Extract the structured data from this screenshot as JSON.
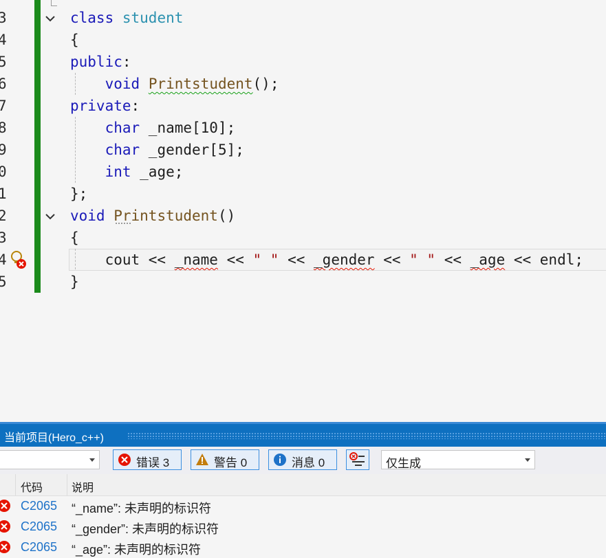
{
  "editor": {
    "line_numbers": [
      "3",
      "4",
      "5",
      "6",
      "7",
      "8",
      "9",
      "0",
      "1",
      "2",
      "3",
      "4",
      "5"
    ],
    "lines": [
      {
        "tokens": [
          {
            "t": "class",
            "c": "kw"
          },
          {
            "t": " "
          },
          {
            "t": "student",
            "c": "ty"
          }
        ]
      },
      {
        "tokens": [
          {
            "t": "{"
          }
        ]
      },
      {
        "tokens": [
          {
            "t": "public",
            "c": "kw"
          },
          {
            "t": ":"
          }
        ]
      },
      {
        "tokens": [
          {
            "t": "    "
          },
          {
            "t": "void",
            "c": "kw"
          },
          {
            "t": " "
          },
          {
            "t": "Printstudent",
            "c": "fn sq-green"
          },
          {
            "t": "();"
          }
        ]
      },
      {
        "tokens": [
          {
            "t": "private",
            "c": "kw"
          },
          {
            "t": ":"
          }
        ]
      },
      {
        "tokens": [
          {
            "t": "    "
          },
          {
            "t": "char",
            "c": "kw"
          },
          {
            "t": " _name[10];"
          }
        ]
      },
      {
        "tokens": [
          {
            "t": "    "
          },
          {
            "t": "char",
            "c": "kw"
          },
          {
            "t": " _gender[5];"
          }
        ]
      },
      {
        "tokens": [
          {
            "t": "    "
          },
          {
            "t": "int",
            "c": "kw"
          },
          {
            "t": " _age;"
          }
        ]
      },
      {
        "tokens": [
          {
            "t": "};"
          }
        ]
      },
      {
        "tokens": [
          {
            "t": "void",
            "c": "kw"
          },
          {
            "t": " "
          },
          {
            "t": "Printstudent",
            "c": "fn"
          },
          {
            "t": "()"
          }
        ]
      },
      {
        "tokens": [
          {
            "t": "{"
          }
        ]
      },
      {
        "tokens": [
          {
            "t": "    cout << "
          },
          {
            "t": "_name",
            "c": "sq-red"
          },
          {
            "t": " << "
          },
          {
            "t": "\" \"",
            "c": "st"
          },
          {
            "t": " << "
          },
          {
            "t": "_gender",
            "c": "sq-red"
          },
          {
            "t": " << "
          },
          {
            "t": "\" \"",
            "c": "st"
          },
          {
            "t": " << "
          },
          {
            "t": "_age",
            "c": "sq-red"
          },
          {
            "t": " << endl;"
          }
        ]
      },
      {
        "tokens": [
          {
            "t": "}"
          }
        ]
      }
    ]
  },
  "error_list": {
    "title": "当前项目(Hero_c++)",
    "scope_dropdown_value": "",
    "errors_label": "错误 3",
    "warnings_label": "警告 0",
    "messages_label": "消息 0",
    "build_filter_value": "仅生成",
    "columns": {
      "code": "代码",
      "description": "说明"
    },
    "rows": [
      {
        "code": "C2065",
        "description": "“_name”: 未声明的标识符"
      },
      {
        "code": "C2065",
        "description": "“_gender”: 未声明的标识符"
      },
      {
        "code": "C2065",
        "description": "“_age”: 未声明的标识符"
      }
    ]
  },
  "colors": {
    "keyword": "#1a1ab8",
    "type": "#2b91af",
    "function": "#74531f",
    "string": "#a31515",
    "change_bar": "#1b8a1b",
    "panel_title": "#0e70c0",
    "error_icon": "#e51400"
  }
}
